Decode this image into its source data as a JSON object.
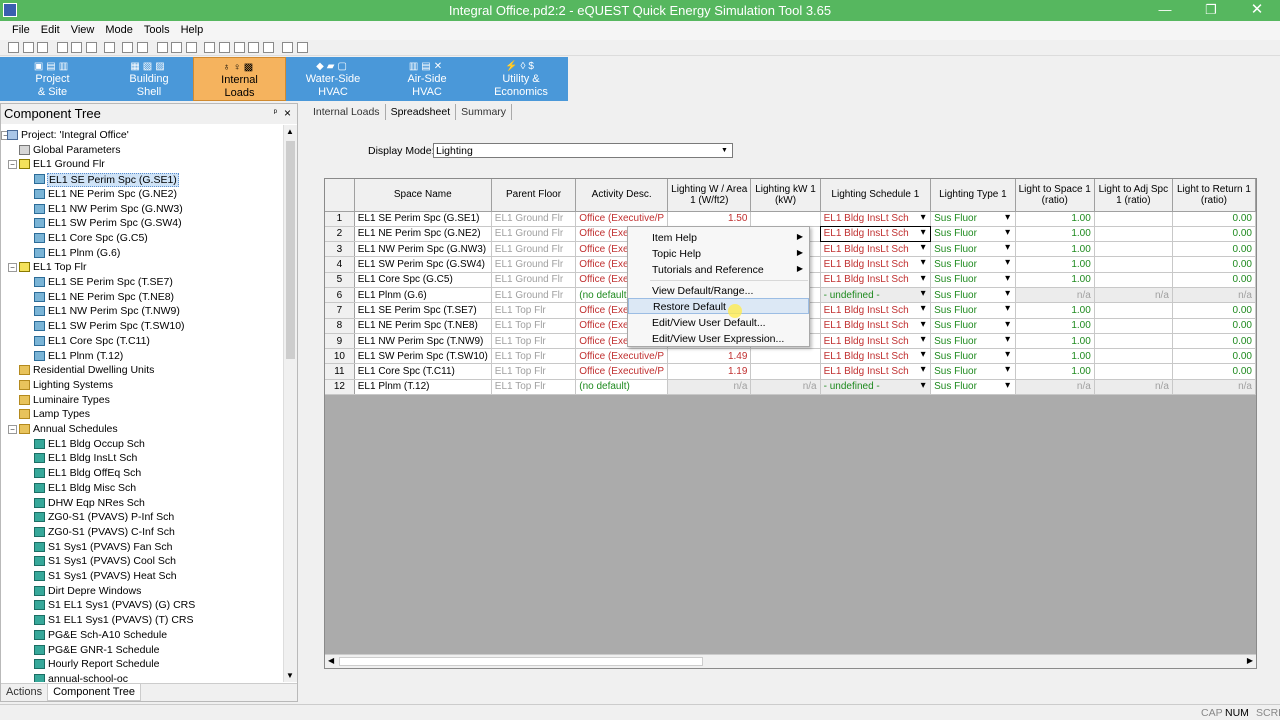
{
  "window": {
    "title": "Integral Office.pd2:2 - eQUEST Quick Energy Simulation Tool 3.65",
    "minimize": "—",
    "restore": "❐",
    "close": "✕"
  },
  "menu": [
    "File",
    "Edit",
    "View",
    "Mode",
    "Tools",
    "Help"
  ],
  "modes": [
    {
      "line1": "Project",
      "line2": "& Site"
    },
    {
      "line1": "Building",
      "line2": "Shell"
    },
    {
      "line1": "Internal",
      "line2": "Loads"
    },
    {
      "line1": "Water-Side",
      "line2": "HVAC"
    },
    {
      "line1": "Air-Side",
      "line2": "HVAC"
    },
    {
      "line1": "Utility &",
      "line2": "Economics"
    }
  ],
  "tree": {
    "header": "Component Tree",
    "items": [
      "Project: 'Integral Office'",
      "Global Parameters",
      "EL1 Ground Flr",
      "EL1 SE Perim Spc (G.SE1)",
      "EL1 NE Perim Spc (G.NE2)",
      "EL1 NW Perim Spc (G.NW3)",
      "EL1 SW Perim Spc (G.SW4)",
      "EL1 Core Spc (G.C5)",
      "EL1 Plnm (G.6)",
      "EL1 Top Flr",
      "EL1 SE Perim Spc (T.SE7)",
      "EL1 NE Perim Spc (T.NE8)",
      "EL1 NW Perim Spc (T.NW9)",
      "EL1 SW Perim Spc (T.SW10)",
      "EL1 Core Spc (T.C11)",
      "EL1 Plnm (T.12)",
      "Residential Dwelling Units",
      "Lighting Systems",
      "Luminaire Types",
      "Lamp Types",
      "Annual Schedules",
      "EL1 Bldg Occup Sch",
      "EL1 Bldg InsLt Sch",
      "EL1 Bldg OffEq Sch",
      "EL1 Bldg Misc Sch",
      "DHW Eqp NRes Sch",
      "ZG0-S1 (PVAVS) P-Inf Sch",
      "ZG0-S1 (PVAVS) C-Inf Sch",
      "S1 Sys1 (PVAVS) Fan Sch",
      "S1 Sys1 (PVAVS) Cool Sch",
      "S1 Sys1 (PVAVS) Heat Sch",
      "Dirt Depre Windows",
      "S1 EL1 Sys1 (PVAVS) (G) CRS",
      "S1 EL1 Sys1 (PVAVS) (T) CRS",
      "PG&E Sch-A10 Schedule",
      "PG&E GNR-1 Schedule",
      "Hourly Report Schedule",
      "annual-school-oc"
    ],
    "tabs": [
      "Actions",
      "Component Tree"
    ]
  },
  "main": {
    "tabs": [
      "Internal Loads",
      "Spreadsheet",
      "Summary"
    ],
    "display_mode_label": "Display Mode:",
    "display_mode_value": "Lighting",
    "columns": [
      "",
      "Space Name",
      "Parent Floor",
      "Activity Desc.",
      "Lighting W / Area 1 (W/ft2)",
      "Lighting kW 1 (kW)",
      "Lighting Schedule 1",
      "Lighting Type 1",
      "Light to Space 1 (ratio)",
      "Light to Adj Spc 1 (ratio)",
      "Light to Return 1 (ratio)"
    ],
    "rows": [
      [
        "1",
        "EL1 SE Perim Spc (G.SE1)",
        "EL1 Ground Flr",
        "Office (Executive/P",
        "1.50",
        "",
        "EL1 Bldg InsLt Sch",
        "Sus Fluor",
        "1.00",
        "",
        "0.00"
      ],
      [
        "2",
        "EL1 NE Perim Spc (G.NE2)",
        "EL1 Ground Flr",
        "Office (Execu",
        "",
        "",
        "EL1 Bldg InsLt Sch",
        "Sus Fluor",
        "1.00",
        "",
        "0.00"
      ],
      [
        "3",
        "EL1 NW Perim Spc (G.NW3)",
        "EL1 Ground Flr",
        "Office (Execu",
        "",
        "",
        "EL1 Bldg InsLt Sch",
        "Sus Fluor",
        "1.00",
        "",
        "0.00"
      ],
      [
        "4",
        "EL1 SW Perim Spc (G.SW4)",
        "EL1 Ground Flr",
        "Office (Execu",
        "",
        "",
        "EL1 Bldg InsLt Sch",
        "Sus Fluor",
        "1.00",
        "",
        "0.00"
      ],
      [
        "5",
        "EL1 Core Spc (G.C5)",
        "EL1 Ground Flr",
        "Office (Execu",
        "",
        "",
        "EL1 Bldg InsLt Sch",
        "Sus Fluor",
        "1.00",
        "",
        "0.00"
      ],
      [
        "6",
        "EL1 Plnm (G.6)",
        "EL1 Ground Flr",
        "(no default)",
        "",
        "",
        "- undefined -",
        "Sus Fluor",
        "n/a",
        "n/a",
        "n/a"
      ],
      [
        "7",
        "EL1 SE Perim Spc (T.SE7)",
        "EL1 Top Flr",
        "Office (Execu",
        "",
        "",
        "EL1 Bldg InsLt Sch",
        "Sus Fluor",
        "1.00",
        "",
        "0.00"
      ],
      [
        "8",
        "EL1 NE Perim Spc (T.NE8)",
        "EL1 Top Flr",
        "Office (Execu",
        "",
        "",
        "EL1 Bldg InsLt Sch",
        "Sus Fluor",
        "1.00",
        "",
        "0.00"
      ],
      [
        "9",
        "EL1 NW Perim Spc (T.NW9)",
        "EL1 Top Flr",
        "Office (Execu",
        "",
        "",
        "EL1 Bldg InsLt Sch",
        "Sus Fluor",
        "1.00",
        "",
        "0.00"
      ],
      [
        "10",
        "EL1 SW Perim Spc (T.SW10)",
        "EL1 Top Flr",
        "Office (Executive/P",
        "1.49",
        "",
        "EL1 Bldg InsLt Sch",
        "Sus Fluor",
        "1.00",
        "",
        "0.00"
      ],
      [
        "11",
        "EL1 Core Spc (T.C11)",
        "EL1 Top Flr",
        "Office (Executive/P",
        "1.19",
        "",
        "EL1 Bldg InsLt Sch",
        "Sus Fluor",
        "1.00",
        "",
        "0.00"
      ],
      [
        "12",
        "EL1 Plnm (T.12)",
        "EL1 Top Flr",
        "(no default)",
        "n/a",
        "n/a",
        "- undefined -",
        "Sus Fluor",
        "n/a",
        "n/a",
        "n/a"
      ]
    ]
  },
  "context_menu": [
    "Item Help",
    "Topic Help",
    "Tutorials and Reference",
    "View Default/Range...",
    "Restore Default",
    "Edit/View User Default...",
    "Edit/View User Expression..."
  ],
  "status": [
    "CAP",
    "NUM",
    "SCRL"
  ]
}
